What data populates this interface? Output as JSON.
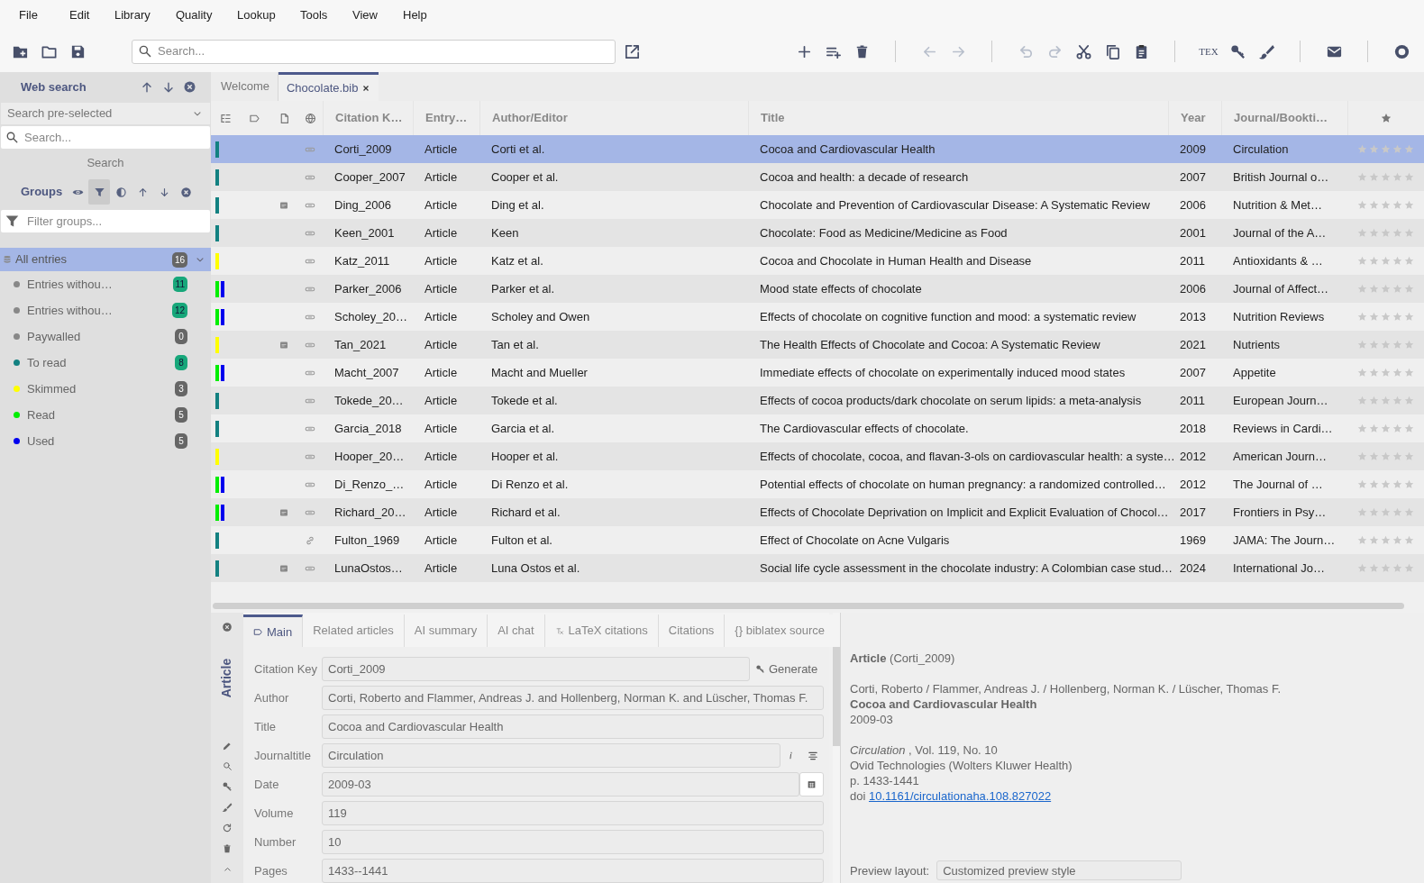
{
  "menu": [
    "File",
    "Edit",
    "Library",
    "Quality",
    "Lookup",
    "Tools",
    "View",
    "Help"
  ],
  "toolbar": {
    "search_placeholder": "Search...",
    "buttons": [
      {
        "disabled": false
      },
      {
        "disabled": false
      },
      {
        "disabled": false
      },
      {
        "disabled": false
      },
      {
        "disabled": false
      },
      {
        "disabled": false
      },
      {
        "disabled": false
      },
      {
        "disabled": true
      },
      {
        "disabled": true
      },
      {
        "disabled": true
      },
      {
        "disabled": true
      },
      {
        "disabled": false
      },
      {
        "disabled": false
      },
      {
        "disabled": false
      },
      {
        "disabled": false,
        "label": "TEX"
      },
      {
        "disabled": false
      },
      {
        "disabled": false
      },
      {
        "disabled": false
      },
      {
        "disabled": false
      }
    ]
  },
  "web_search": {
    "title": "Web search",
    "source": "Search pre-selected",
    "placeholder": "Search...",
    "button": "Search"
  },
  "groups_panel": {
    "title": "Groups",
    "filter_placeholder": "Filter groups...",
    "tools": [
      {
        "selected": false
      },
      {
        "selected": true
      },
      {
        "selected": false
      },
      {
        "selected": false
      },
      {
        "selected": false
      },
      {
        "selected": false
      }
    ]
  },
  "groups": [
    {
      "name": "All entries",
      "count": "16",
      "selected": true,
      "expanded": true,
      "highlighted": false,
      "children": [
        {
          "name": "Entries withou…",
          "count": "11",
          "color": "#888888",
          "highlighted": true,
          "selected": false
        },
        {
          "name": "Entries withou…",
          "count": "12",
          "color": "#888888",
          "highlighted": true,
          "selected": false
        },
        {
          "name": "Paywalled",
          "count": "0",
          "color": "#888888",
          "highlighted": false,
          "selected": false
        },
        {
          "name": "To read",
          "count": "8",
          "color": "#138181",
          "highlighted": true,
          "selected": false
        },
        {
          "name": "Skimmed",
          "count": "3",
          "color": "#ffff00",
          "highlighted": false,
          "selected": false
        },
        {
          "name": "Read",
          "count": "5",
          "color": "#00ee00",
          "highlighted": false,
          "selected": false
        },
        {
          "name": "Used",
          "count": "5",
          "color": "#0000ee",
          "highlighted": false,
          "selected": false
        }
      ]
    }
  ],
  "library_tabs": [
    {
      "label": "Welcome",
      "selected": false,
      "closable": false
    },
    {
      "label": "Chocolate.bib",
      "selected": true,
      "closable": true
    }
  ],
  "table": {
    "columns": [
      "Citation K…",
      "Entry…",
      "Author/Editor",
      "Title",
      "Year",
      "Journal/Bookti…"
    ],
    "rows": [
      {
        "groups": [
          {
            "color": "#138181"
          }
        ],
        "pdf": false,
        "link": {
          "kind": "doi"
        },
        "key": "Corti_2009",
        "type": "Article",
        "author": "Corti et al.",
        "title": "Cocoa and Cardiovascular Health",
        "year": "2009",
        "journal": "Circulation",
        "stars": 0,
        "selected": true
      },
      {
        "groups": [
          {
            "color": "#138181"
          }
        ],
        "pdf": false,
        "link": {
          "kind": "doi"
        },
        "key": "Cooper_2007",
        "type": "Article",
        "author": "Cooper et al.",
        "title": "Cocoa and health: a decade of research",
        "year": "2007",
        "journal": "British Journal o…",
        "stars": 0,
        "selected": false
      },
      {
        "groups": [
          {
            "color": "#138181"
          }
        ],
        "pdf": true,
        "link": {
          "kind": "doi"
        },
        "key": "Ding_2006",
        "type": "Article",
        "author": "Ding et al.",
        "title": "Chocolate and Prevention of Cardiovascular Disease: A Systematic Review",
        "year": "2006",
        "journal": "Nutrition & Met…",
        "stars": 0,
        "selected": false
      },
      {
        "groups": [
          {
            "color": "#138181"
          }
        ],
        "pdf": false,
        "link": {
          "kind": "doi"
        },
        "key": "Keen_2001",
        "type": "Article",
        "author": "Keen",
        "title": "Chocolate: Food as Medicine/Medicine as Food",
        "year": "2001",
        "journal": "Journal of the A…",
        "stars": 0,
        "selected": false
      },
      {
        "groups": [
          {
            "color": "#ffff00"
          }
        ],
        "pdf": false,
        "link": {
          "kind": "doi"
        },
        "key": "Katz_2011",
        "type": "Article",
        "author": "Katz et al.",
        "title": "Cocoa and Chocolate in Human Health and Disease",
        "year": "2011",
        "journal": "Antioxidants & …",
        "stars": 0,
        "selected": false
      },
      {
        "groups": [
          {
            "color": "#00ee00"
          },
          {
            "color": "#0000ee"
          }
        ],
        "pdf": false,
        "link": {
          "kind": "doi"
        },
        "key": "Parker_2006",
        "type": "Article",
        "author": "Parker et al.",
        "title": "Mood state effects of chocolate",
        "year": "2006",
        "journal": "Journal of Affect…",
        "stars": 0,
        "selected": false
      },
      {
        "groups": [
          {
            "color": "#00ee00"
          },
          {
            "color": "#0000ee"
          }
        ],
        "pdf": false,
        "link": {
          "kind": "doi"
        },
        "key": "Scholey_20…",
        "type": "Article",
        "author": "Scholey and Owen",
        "title": "Effects of chocolate on cognitive function and mood: a systematic review",
        "year": "2013",
        "journal": "Nutrition Reviews",
        "stars": 0,
        "selected": false
      },
      {
        "groups": [
          {
            "color": "#ffff00"
          }
        ],
        "pdf": true,
        "link": {
          "kind": "doi"
        },
        "key": "Tan_2021",
        "type": "Article",
        "author": "Tan et al.",
        "title": "The Health Effects of Chocolate and Cocoa: A Systematic Review",
        "year": "2021",
        "journal": "Nutrients",
        "stars": 0,
        "selected": false
      },
      {
        "groups": [
          {
            "color": "#00ee00"
          },
          {
            "color": "#0000ee"
          }
        ],
        "pdf": false,
        "link": {
          "kind": "doi"
        },
        "key": "Macht_2007",
        "type": "Article",
        "author": "Macht and Mueller",
        "title": "Immediate effects of chocolate on experimentally induced mood states",
        "year": "2007",
        "journal": "Appetite",
        "stars": 0,
        "selected": false
      },
      {
        "groups": [
          {
            "color": "#138181"
          }
        ],
        "pdf": false,
        "link": {
          "kind": "doi"
        },
        "key": "Tokede_20…",
        "type": "Article",
        "author": "Tokede et al.",
        "title": "Effects of cocoa products/dark chocolate on serum lipids: a meta-analysis",
        "year": "2011",
        "journal": "European Journ…",
        "stars": 0,
        "selected": false
      },
      {
        "groups": [
          {
            "color": "#138181"
          }
        ],
        "pdf": false,
        "link": {
          "kind": "doi"
        },
        "key": "Garcia_2018",
        "type": "Article",
        "author": "Garcia et al.",
        "title": "The Cardiovascular effects of chocolate.",
        "year": "2018",
        "journal": "Reviews in Cardi…",
        "stars": 0,
        "selected": false
      },
      {
        "groups": [
          {
            "color": "#ffff00"
          }
        ],
        "pdf": false,
        "link": {
          "kind": "doi"
        },
        "key": "Hooper_20…",
        "type": "Article",
        "author": "Hooper et al.",
        "title": "Effects of chocolate, cocoa, and flavan-3-ols on cardiovascular health: a syste…",
        "year": "2012",
        "journal": "American Journ…",
        "stars": 0,
        "selected": false
      },
      {
        "groups": [
          {
            "color": "#00ee00"
          },
          {
            "color": "#0000ee"
          }
        ],
        "pdf": false,
        "link": {
          "kind": "doi"
        },
        "key": "Di_Renzo_…",
        "type": "Article",
        "author": "Di Renzo et al.",
        "title": "Potential effects of chocolate on human pregnancy: a randomized controlled…",
        "year": "2012",
        "journal": "The Journal of …",
        "stars": 0,
        "selected": false
      },
      {
        "groups": [
          {
            "color": "#00ee00"
          },
          {
            "color": "#0000ee"
          }
        ],
        "pdf": true,
        "link": {
          "kind": "doi"
        },
        "key": "Richard_20…",
        "type": "Article",
        "author": "Richard et al.",
        "title": "Effects of Chocolate Deprivation on Implicit and Explicit Evaluation of Chocol…",
        "year": "2017",
        "journal": "Frontiers in Psy…",
        "stars": 0,
        "selected": false
      },
      {
        "groups": [
          {
            "color": "#138181"
          }
        ],
        "pdf": false,
        "link": {
          "kind": "url"
        },
        "key": "Fulton_1969",
        "type": "Article",
        "author": "Fulton et al.",
        "title": "Effect of Chocolate on Acne Vulgaris",
        "year": "1969",
        "journal": "JAMA: The Journ…",
        "stars": 0,
        "selected": false
      },
      {
        "groups": [
          {
            "color": "#138181"
          }
        ],
        "pdf": true,
        "link": {
          "kind": "doi"
        },
        "key": "LunaOstos…",
        "type": "Article",
        "author": "Luna Ostos et al.",
        "title": "Social life cycle assessment in the chocolate industry: A Colombian case stud…",
        "year": "2024",
        "journal": "International Jo…",
        "stars": 0,
        "selected": false
      }
    ]
  },
  "editor": {
    "entry_type": "Article",
    "tabs": [
      {
        "label": "Main",
        "selected": true
      },
      {
        "label": "Related articles",
        "selected": false
      },
      {
        "label": "AI summary",
        "selected": false
      },
      {
        "label": "AI chat",
        "selected": false
      },
      {
        "label": "LaTeX citations",
        "selected": false
      },
      {
        "label": "Citations",
        "selected": false
      },
      {
        "label": "{} biblatex source",
        "selected": false
      }
    ],
    "fields": [
      {
        "kind": "key",
        "label": "Citation Key",
        "value": "Corti_2009",
        "action": "Generate"
      },
      {
        "kind": "plain",
        "label": "Author",
        "value": "Corti, Roberto and Flammer, Andreas J. and Hollenberg, Norman K. and Lüscher, Thomas F."
      },
      {
        "kind": "plain",
        "label": "Title",
        "value": "Cocoa and Cardiovascular Health"
      },
      {
        "kind": "journal",
        "label": "Journaltitle",
        "value": "Circulation"
      },
      {
        "kind": "date",
        "label": "Date",
        "value": "2009-03"
      },
      {
        "kind": "plain",
        "label": "Volume",
        "value": "119"
      },
      {
        "kind": "plain",
        "label": "Number",
        "value": "10"
      },
      {
        "kind": "plain",
        "label": "Pages",
        "value": "1433--1441"
      }
    ]
  },
  "preview": {
    "heading": "**Article** (Corti_2009)",
    "authors": "Corti, Roberto / Flammer, Andreas J. / Hollenberg, Norman K. / Lüscher, Thomas F.",
    "title": "Cocoa and Cardiovascular Health",
    "date": "2009-03",
    "journal_line": "*Circulation* , Vol. 119, No. 10",
    "publisher": "Ovid Technologies (Wolters Kluwer Health)",
    "pages": "p. 1433-1441",
    "doi_label": "doi",
    "doi": "10.1161/circulationaha.108.827022",
    "layout_label": "Preview layout:",
    "layout_value": "Customized preview style"
  }
}
